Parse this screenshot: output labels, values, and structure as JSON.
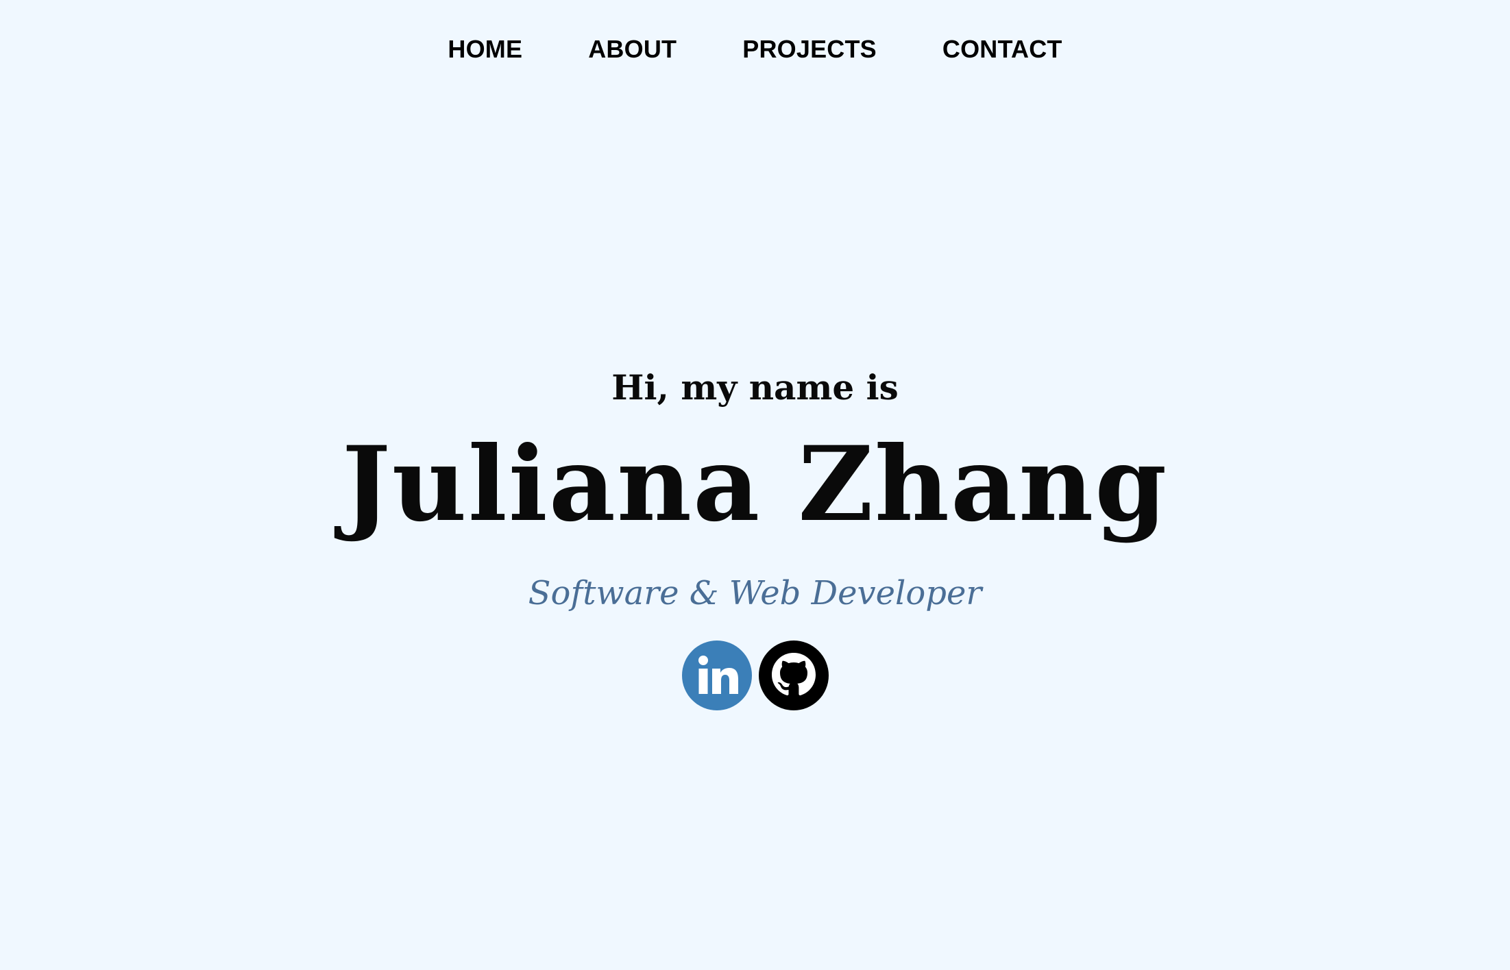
{
  "nav": {
    "items": [
      {
        "label": "HOME"
      },
      {
        "label": "ABOUT"
      },
      {
        "label": "PROJECTS"
      },
      {
        "label": "CONTACT"
      }
    ]
  },
  "hero": {
    "greeting": "Hi, my name is",
    "name": "Juliana Zhang",
    "role": "Software & Web Developer"
  },
  "socials": [
    {
      "icon": "linkedin-icon",
      "color": "#3b7fb8"
    },
    {
      "icon": "github-icon",
      "color": "#000000"
    }
  ],
  "colors": {
    "background": "#f0f8ff",
    "text": "#0a0a0a",
    "accent": "#4a6e96"
  }
}
